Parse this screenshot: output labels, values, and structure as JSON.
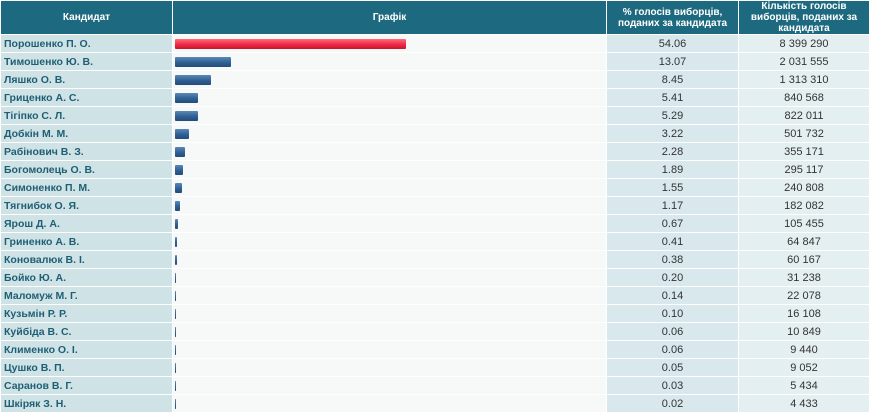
{
  "header": {
    "col_candidate": "Кандидат",
    "col_chart": "Графік",
    "col_percent": "% голосів виборців, поданих за кандидата",
    "col_votes": "Кількість голосів виборців, поданих за кандидата"
  },
  "colors": {
    "leader_bar": "#ee2a45",
    "other_bar": "#2f5f93",
    "header_bg": "#1d6a80"
  },
  "chart_data": {
    "type": "bar",
    "orientation": "horizontal",
    "categories": [
      "Порошенко П. О.",
      "Тимошенко Ю. В.",
      "Ляшко О. В.",
      "Гриценко А. С.",
      "Тігіпко С. Л.",
      "Добкін М. М.",
      "Рабінович В. З.",
      "Богомолець О. В.",
      "Симоненко П. М.",
      "Тягнибок О. Я.",
      "Ярош Д. А.",
      "Гриненко А. В.",
      "Коновалюк В. І.",
      "Бойко Ю. А.",
      "Маломуж М. Г.",
      "Кузьмін Р. Р.",
      "Куйбіда В. С.",
      "Клименко О. І.",
      "Цушко В. П.",
      "Саранов В. Г.",
      "Шкіряк З. Н."
    ],
    "percent_labels": [
      "54.06",
      "13.07",
      "8.45",
      "5.41",
      "5.29",
      "3.22",
      "2.28",
      "1.89",
      "1.55",
      "1.17",
      "0.67",
      "0.41",
      "0.38",
      "0.20",
      "0.14",
      "0.10",
      "0.06",
      "0.06",
      "0.05",
      "0.03",
      "0.02"
    ],
    "values": [
      54.06,
      13.07,
      8.45,
      5.41,
      5.29,
      3.22,
      2.28,
      1.89,
      1.55,
      1.17,
      0.67,
      0.41,
      0.38,
      0.2,
      0.14,
      0.1,
      0.06,
      0.06,
      0.05,
      0.03,
      0.02
    ],
    "votes": [
      "8 399 290",
      "2 031 555",
      "1 313 310",
      "840 568",
      "822 011",
      "501 732",
      "355 171",
      "295 117",
      "240 808",
      "182 082",
      "105 455",
      "64 847",
      "60 167",
      "31 238",
      "22 078",
      "16 108",
      "10 849",
      "9 440",
      "9 052",
      "5 434",
      "4 433"
    ],
    "xlim": [
      0,
      100
    ]
  }
}
